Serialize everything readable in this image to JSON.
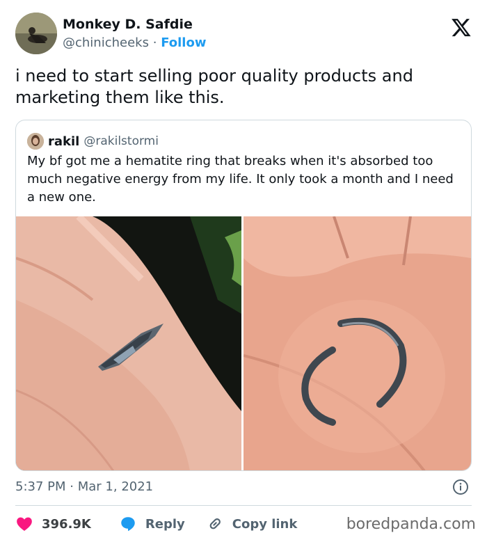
{
  "author": {
    "display_name": "Monkey D. Safdie",
    "handle": "@chinicheeks",
    "separator": "·",
    "follow_label": "Follow"
  },
  "tweet": {
    "text": "i need to start selling poor quality products and marketing them like this."
  },
  "quoted_tweet": {
    "display_name": "rakil",
    "handle": "@rakilstormi",
    "text": "My bf got me a hematite ring that breaks when it's absorbed too much negative energy from my life. It only took a month and I need a new one."
  },
  "meta": {
    "time": "5:37 PM",
    "separator": "·",
    "date": "Mar 1, 2021"
  },
  "actions": {
    "likes": "396.9K",
    "reply_label": "Reply",
    "copy_label": "Copy link"
  },
  "watermark": "boredpanda.com",
  "colors": {
    "accent": "#1d9bf0",
    "like": "#f91880",
    "muted": "#536471",
    "border": "#cfd9de"
  },
  "icons": [
    "x-logo-icon",
    "info-icon",
    "heart-icon",
    "reply-bubble-icon",
    "link-icon"
  ]
}
